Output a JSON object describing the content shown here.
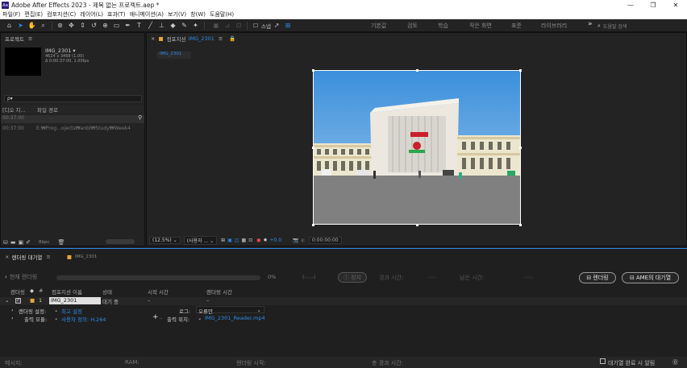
{
  "window": {
    "title": "Adobe After Effects 2023 - 제목 없는 프로젝트.aep *",
    "logo": "Ae",
    "controls": [
      "—",
      "❐",
      "✕"
    ]
  },
  "menu": [
    "파일(F)",
    "편집(E)",
    "컴포지션(C)",
    "레이어(L)",
    "효과(T)",
    "애니메이션(A)",
    "보기(V)",
    "창(W)",
    "도움말(H)"
  ],
  "toolbar": {
    "snap_label": "스냅",
    "workspaces": [
      "기본값",
      "검토",
      "학습",
      "작은 화면",
      "표준",
      "라이브러리"
    ],
    "more": "»",
    "search_placeholder": "도움말 검색"
  },
  "project": {
    "tab_label": "프로젝트",
    "item_name": "IMG_2301",
    "item_dims": "4624 x 3468 (1.00)",
    "item_duration": "Δ 0:00:37:00, 1.00fps",
    "search_placeholder": "ρ▾",
    "col_duration": "[디오 지...",
    "col_path": "파일 경로",
    "row1": "00:37:00",
    "row2_dur": "00:37:00",
    "row2_path": "E:₩Prog...ojects₩anbl₩Study₩Week4",
    "bpc": "8bpc"
  },
  "comp": {
    "tab_label": "컴포지션",
    "comp_name": "IMG_2301",
    "sub_tab": "IMG_2301",
    "zoom": "(12.5%)",
    "view_mode": "(사용자 ...",
    "exposure": "+0.0",
    "timecode": "0:00:00:00"
  },
  "render": {
    "tab_label": "렌더링 대기열",
    "tab2_label": "IMG_2301",
    "current_render": "현재 렌더링",
    "progress": "0%",
    "progress_frames": "(-.-.-)",
    "stop_label": "정지",
    "elapsed_label": "경과 시간:",
    "elapsed_value": "-:-:-",
    "remaining_label": "남은 시간:",
    "remaining_value": "-:-:-",
    "render_button": "렌더링",
    "ame_button": "AME의 대기열",
    "headers": [
      "렌더링",
      "#",
      "컴포지션 이름",
      "상태",
      "시작 시간",
      "렌더링 시간"
    ],
    "item_num": "1",
    "item_name": "IMG_2301",
    "item_status": "대기 중",
    "item_start": "–",
    "item_render_time": "–",
    "render_settings_label": "렌더링 설정:",
    "render_settings_value": "최고 설정",
    "log_label": "로그:",
    "log_value": "오류만",
    "output_module_label": "출력 모듈:",
    "output_module_value": "사용자 정의: H.264",
    "output_to_label": "출력 위치:",
    "output_to_value": "IMG_2301_Reader.mp4",
    "status_message": "메시지:",
    "status_ram": "RAM:",
    "status_render_start": "렌더링 시작:",
    "status_total_elapsed": "총 경과 시간:",
    "notify_label": "대기열 완료 시 알림"
  },
  "colors": {
    "accent": "#2d8ceb",
    "panel": "#232323",
    "background": "#1d1d1d"
  }
}
